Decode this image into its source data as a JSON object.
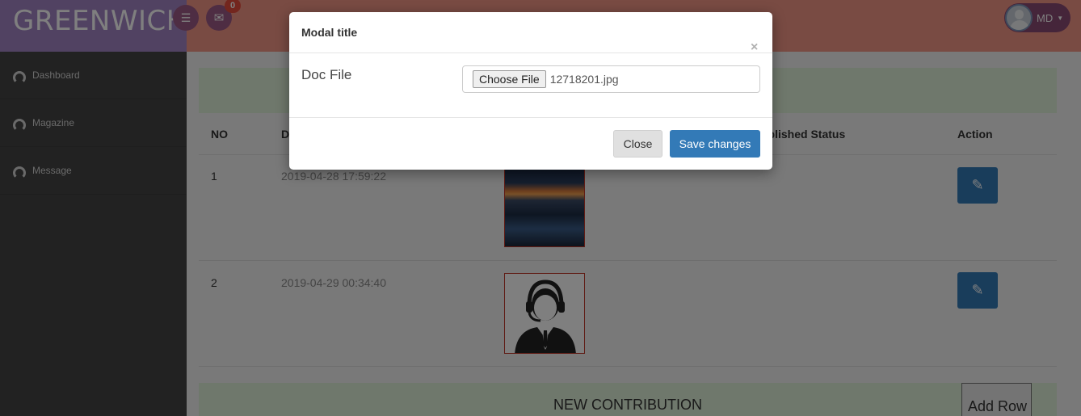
{
  "header": {
    "brand": "GREENWICH",
    "notification_count": "0",
    "user_initials": "MD"
  },
  "sidebar": {
    "items": [
      {
        "label": "Dashboard",
        "icon": "dashboard-icon"
      },
      {
        "label": "Magazine",
        "icon": "dashboard-icon"
      },
      {
        "label": "Message",
        "icon": "dashboard-icon"
      }
    ]
  },
  "table": {
    "headers": [
      "NO",
      "D",
      "ublished Status",
      "Action"
    ],
    "rows": [
      {
        "no": "1",
        "date": "2019-04-28 17:59:22",
        "thumbnail": "sunset-beach-image"
      },
      {
        "no": "2",
        "date": "2019-04-29 00:34:40",
        "thumbnail": "support-agent-image"
      }
    ]
  },
  "footer": {
    "title": "NEW CONTRIBUTION",
    "add_row_label": "Add Row"
  },
  "modal": {
    "title": "Modal title",
    "close_symbol": "×",
    "field_label": "Doc File",
    "choose_file_label": "Choose File",
    "file_name": "12718201.jpg",
    "close_button": "Close",
    "save_button": "Save changes"
  },
  "colors": {
    "brand_bg": "#a385c4",
    "topbar_bg": "#f39686",
    "primary": "#337ab7",
    "alert_bg": "#dff0d8"
  }
}
